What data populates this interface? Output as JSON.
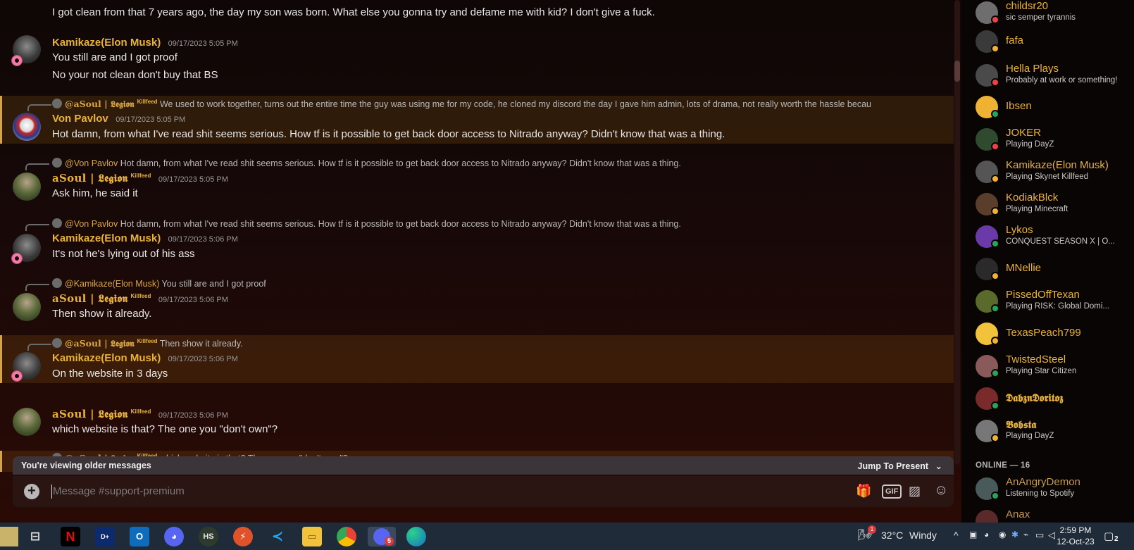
{
  "chat": {
    "m0": {
      "text": "I got clean from that 7 years ago, the day my son was born. What else you gonna try and defame me with kid? I don't give a fuck."
    },
    "m1": {
      "user": "Kamikaze(Elon Musk)",
      "time": "09/17/2023 5:05 PM",
      "line1": "You still are and I got proof",
      "line2": "No your not clean don't buy that BS"
    },
    "m2": {
      "reply_user": "@aSoul | 𝕷𝖊𝖌𝖎𝖔𝖓",
      "reply_tag": "Killfeed",
      "reply_text": "We used to work together, turns out the entire time the guy was using me for my code, he cloned my discord the day I gave him admin, lots of drama, not really worth the hassle becau",
      "user": "Von Pavlov",
      "time": "09/17/2023 5:05 PM",
      "text": "Hot damn, from what I've read shit seems serious. How tf is it possible to get back door access to Nitrado anyway? Didn't know that was a thing."
    },
    "m3": {
      "reply_user": "@Von Pavlov",
      "reply_text": "Hot damn, from what I've read shit seems serious. How tf is it possible to get back door access to Nitrado anyway? Didn't know that was a thing.",
      "user": "aSoul | 𝕷𝖊𝖌𝖎𝖔𝖓",
      "tag": "Killfeed",
      "time": "09/17/2023 5:05 PM",
      "text": "Ask him, he said it"
    },
    "m4": {
      "reply_user": "@Von Pavlov",
      "reply_text": "Hot damn, from what I've read shit seems serious. How tf is it possible to get back door access to Nitrado anyway? Didn't know that was a thing.",
      "user": "Kamikaze(Elon Musk)",
      "time": "09/17/2023 5:06 PM",
      "text": "It's not he's lying out of his ass"
    },
    "m5": {
      "reply_user": "@Kamikaze(Elon Musk)",
      "reply_text": "You still are and I got proof",
      "user": "aSoul | 𝕷𝖊𝖌𝖎𝖔𝖓",
      "tag": "Killfeed",
      "time": "09/17/2023 5:06 PM",
      "text": "Then show it already."
    },
    "m6": {
      "reply_user": "@aSoul | 𝕷𝖊𝖌𝖎𝖔𝖓",
      "reply_tag": "Killfeed",
      "reply_text": "Then show it already.",
      "user": "Kamikaze(Elon Musk)",
      "time": "09/17/2023 5:06 PM",
      "text": "On the website in 3 days"
    },
    "m7": {
      "user": "aSoul | 𝕷𝖊𝖌𝖎𝖔𝖓",
      "tag": "Killfeed",
      "time": "09/17/2023 5:06 PM",
      "text": "which website is that? The one you \"don't own\"?"
    },
    "m8": {
      "reply_user": "@aSoul | 𝕷𝖊𝖌𝖎𝖔𝖓",
      "reply_tag": "Killfeed",
      "reply_text": "which website is that? The one you \"don't own\"?"
    },
    "older_notice": "You're viewing older messages",
    "jump_label": "Jump To Present",
    "composer_placeholder": "Message #support-premium"
  },
  "members": {
    "list": [
      {
        "name": "childsr20",
        "sub": "sic semper tyrannis",
        "status": "dnd"
      },
      {
        "name": "fafa",
        "sub": "",
        "status": "idle"
      },
      {
        "name": "Hella Plays",
        "sub": "Probably at work or something!",
        "status": "dnd"
      },
      {
        "name": "Ibsen",
        "sub": "",
        "status": "online"
      },
      {
        "name": "JOKER",
        "sub": "Playing DayZ",
        "status": "dnd"
      },
      {
        "name": "Kamikaze(Elon Musk)",
        "sub": "Playing Skynet Killfeed",
        "status": "idle"
      },
      {
        "name": "KodiakBlck",
        "sub": "Playing Minecraft",
        "status": "idle"
      },
      {
        "name": "Lykos",
        "sub": "CONQUEST SEASON X | O...",
        "status": "online"
      },
      {
        "name": "MNellie",
        "sub": "",
        "status": "idle"
      },
      {
        "name": "PissedOffTexan",
        "sub": "Playing RISK: Global Domi...",
        "status": "online"
      },
      {
        "name": "TexasPeach799",
        "sub": "",
        "status": "idle"
      },
      {
        "name": "TwistedSteel",
        "sub": "Playing Star Citizen",
        "status": "online"
      },
      {
        "name": "𝕯𝖆𝖇𝖟𝖓𝕯𝖔𝖗𝖎𝖙𝖔𝖟",
        "sub": "",
        "status": "online"
      },
      {
        "name": "𝕭𝖔𝖇𝖘𝖙𝖆",
        "sub": "Playing DayZ",
        "status": "idle"
      }
    ],
    "online_header": "ONLINE — 16",
    "online": [
      {
        "name": "AnAngryDemon",
        "sub": "Listening to Spotify",
        "status": "online"
      },
      {
        "name": "Anax",
        "sub": "",
        "status": "online"
      }
    ]
  },
  "taskbar": {
    "weather_temp": "32°C",
    "weather_desc": "Windy",
    "weather_badge": "1",
    "discord_badge": "5",
    "time": "2:59 PM",
    "date": "12-Oct-23",
    "notif_count": "2",
    "apps": [
      "task-view",
      "netflix",
      "disney-plus",
      "outlook",
      "discord",
      "hs",
      "app-orange",
      "vscode",
      "file-explorer",
      "chrome",
      "discord-active",
      "edge"
    ]
  },
  "colors": {
    "username": "#e8b23a",
    "highlight_border": "#d3a34a",
    "taskbar": "#1f2b38"
  }
}
